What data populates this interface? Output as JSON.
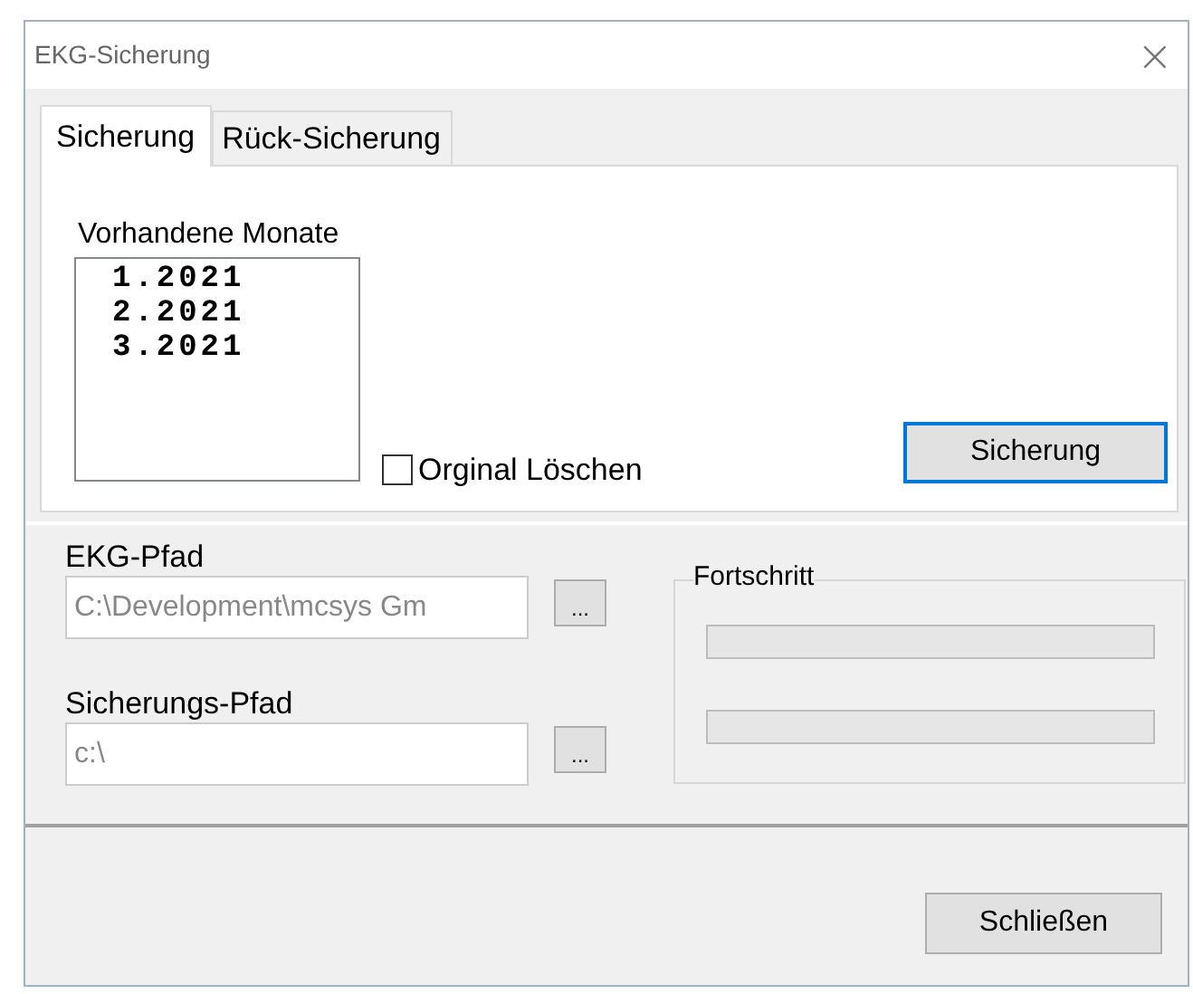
{
  "window": {
    "title": "EKG-Sicherung",
    "close": "×"
  },
  "tabs": [
    {
      "label": "Sicherung",
      "selected": true
    },
    {
      "label": "Rück-Sicherung",
      "selected": false
    }
  ],
  "backup_tab": {
    "months_label": "Vorhandene Monate",
    "months": [
      "1.2021",
      "2.2021",
      "3.2021"
    ],
    "delete_original": {
      "label": "Orginal Löschen",
      "checked": false
    },
    "backup_button": "Sicherung"
  },
  "paths": [
    {
      "label": "EKG-Pfad",
      "value": "C:\\Development\\mcsys Gm",
      "browse": "..."
    },
    {
      "label": "Sicherungs-Pfad",
      "value": "c:\\",
      "browse": "..."
    }
  ],
  "progress": {
    "title": "Fortschritt",
    "bars": [
      {
        "level": 0
      },
      {
        "level": 0
      }
    ]
  },
  "close_button": "Schließen"
}
